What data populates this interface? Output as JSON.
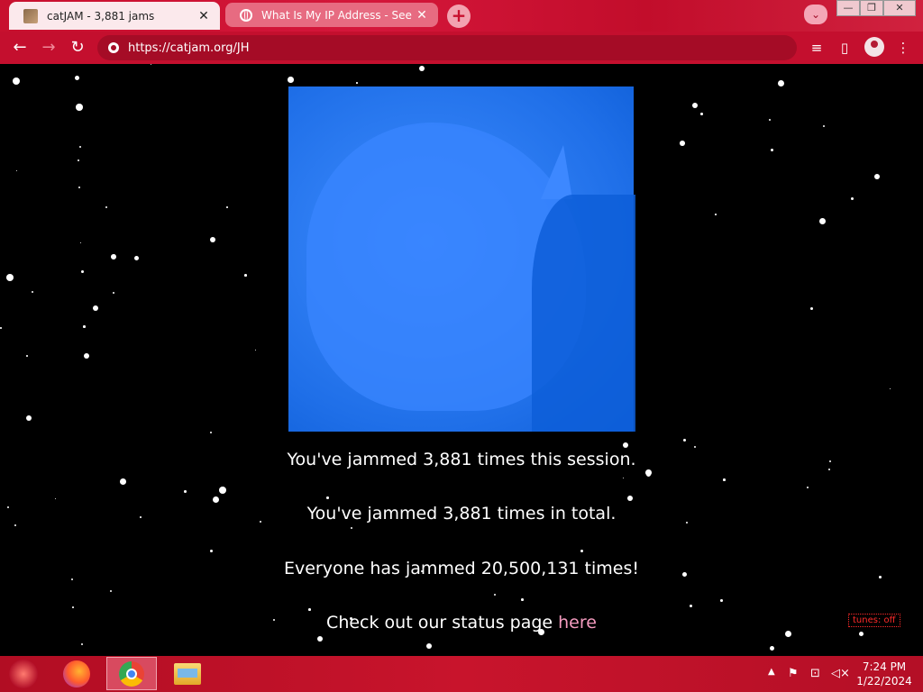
{
  "browser": {
    "tabs": [
      {
        "title": "catJAM - 3,881 jams",
        "close": "✕"
      },
      {
        "title": "What Is My IP Address - See Your",
        "close": "✕"
      }
    ],
    "new_tab": "+",
    "address": "https://catjam.org/JH"
  },
  "window_controls": {
    "minimize": "—",
    "restore": "❐",
    "close": "✕"
  },
  "page": {
    "stats": {
      "session": "You've jammed 3,881 times this session.",
      "total": "You've jammed 3,881 times in total.",
      "everyone": "Everyone has jammed 20,500,131 times!",
      "status_prefix": "Check out our status page ",
      "status_link": "here"
    },
    "tunes": "tunes: off"
  },
  "taskbar": {
    "time": "7:24 PM",
    "date": "1/22/2024"
  },
  "colors": {
    "browser_frame": "#c8102e",
    "link": "#f49bbf",
    "tunes": "#ff2a2a",
    "cat_blue": "#2d7cf2"
  }
}
